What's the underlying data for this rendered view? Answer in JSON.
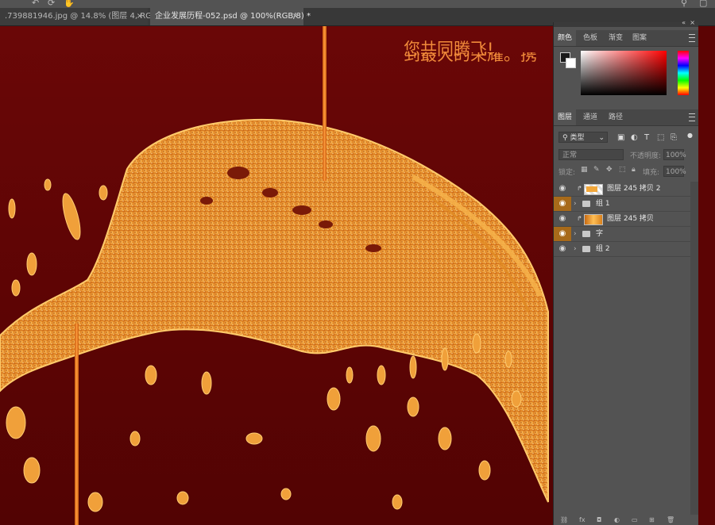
{
  "tabs": [
    {
      "label": ".739881946.jpg @ 14.8% (图层 4, RGB/8) *",
      "close": "×"
    },
    {
      "label": "企业发展历程-052.psd @ 100%(RGB/8) *",
      "close": "×"
    }
  ],
  "canvas": {
    "headline_cut": "到最大的荣耀。携",
    "headline": "您共同腾飞!"
  },
  "color_panel": {
    "tabs": [
      "颜色",
      "色板",
      "渐变",
      "图案"
    ],
    "foreground": "#1a1a1a",
    "background": "#ffffff"
  },
  "layers_panel": {
    "tabs": [
      "图层",
      "通道",
      "路径"
    ],
    "filter_type": "类型",
    "blend_mode": "正常",
    "opacity_label": "不透明度:",
    "opacity_value": "100%",
    "lock_label": "锁定:",
    "fill_label": "填充:",
    "fill_value": "100%",
    "layers": [
      {
        "name": "图层 245 拷贝 2",
        "kind": "image",
        "eye_highlight": false
      },
      {
        "name": "组 1",
        "kind": "group",
        "eye_highlight": true
      },
      {
        "name": "图层 245 拷贝",
        "kind": "image",
        "eye_highlight": false
      },
      {
        "name": "字",
        "kind": "group",
        "eye_highlight": true
      },
      {
        "name": "组 2",
        "kind": "group",
        "eye_highlight": false
      }
    ]
  },
  "colors": {
    "canvas_red": "#6a0707",
    "accent_orange": "#f08a3a",
    "gold": "#e89a2e"
  }
}
